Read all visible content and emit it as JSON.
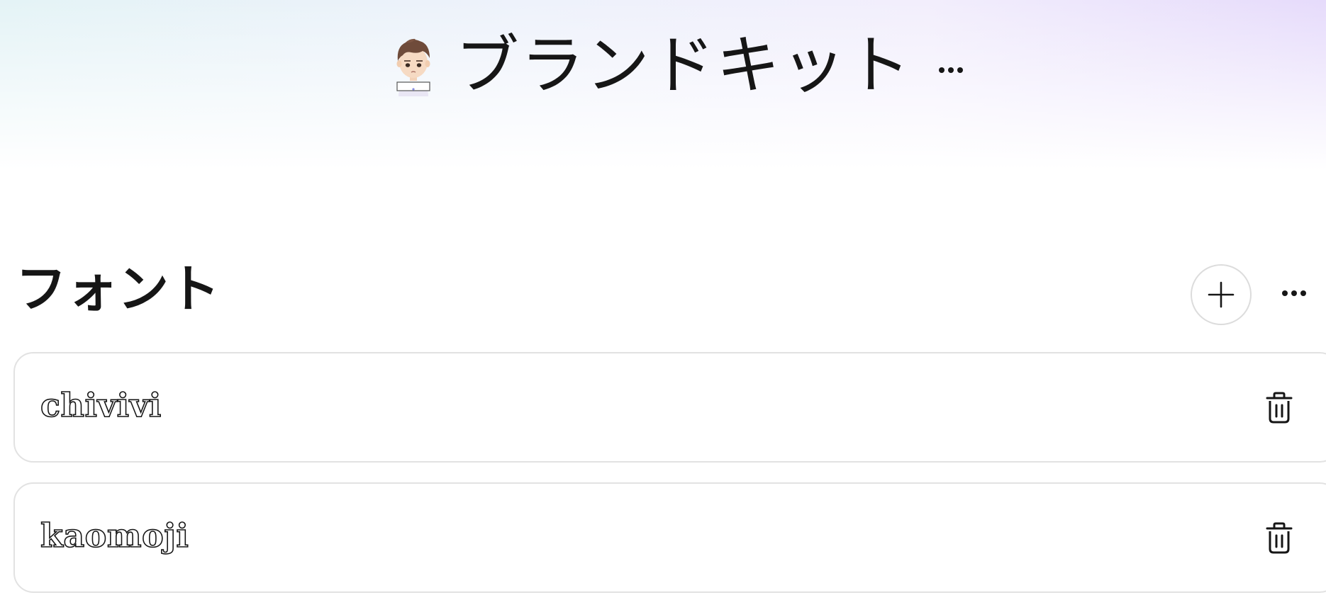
{
  "header": {
    "title": "ブランドキット",
    "avatar_icon": "avatar-illustration",
    "more_icon": "ellipsis-icon"
  },
  "fonts_section": {
    "title": "フォント",
    "add_icon": "plus-icon",
    "more_icon": "ellipsis-icon",
    "items": [
      {
        "name": "chivivi",
        "delete_icon": "trash-icon"
      },
      {
        "name": "kaomoji",
        "delete_icon": "trash-icon"
      }
    ]
  },
  "colors": {
    "text": "#161616",
    "border": "#e2e2e2",
    "gradient_left": "#e4f3f6",
    "gradient_right": "#e6dbfb"
  }
}
